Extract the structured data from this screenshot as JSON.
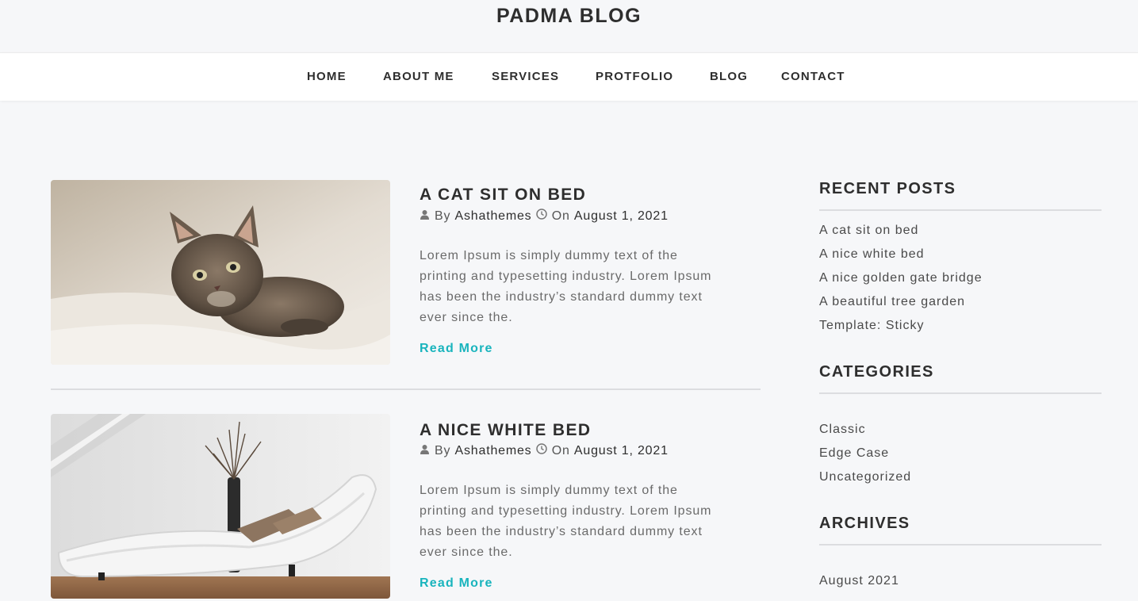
{
  "site": {
    "title": "PADMA BLOG"
  },
  "nav": {
    "items": [
      {
        "label": "HOME"
      },
      {
        "label": "ABOUT ME"
      },
      {
        "label": "SERVICES"
      },
      {
        "label": "PROTFOLIO"
      },
      {
        "label": "BLOG"
      },
      {
        "label": "CONTACT"
      }
    ]
  },
  "posts": [
    {
      "title": "A CAT SIT ON BED",
      "by": "By",
      "author": "Ashathemes",
      "on": "On",
      "date": "August 1, 2021",
      "excerpt": "Lorem Ipsum is simply dummy text of the printing and typesetting industry. Lorem Ipsum has been the industry’s standard dummy text ever since the.",
      "read_more": "Read More",
      "image": "kitten-photo"
    },
    {
      "title": "A NICE WHITE BED",
      "by": "By",
      "author": "Ashathemes",
      "on": "On",
      "date": "August 1, 2021",
      "excerpt": "Lorem Ipsum is simply dummy text of the printing and typesetting industry. Lorem Ipsum has been the industry’s standard dummy text ever since the.",
      "read_more": "Read More",
      "image": "white-chaise-photo"
    }
  ],
  "sidebar": {
    "recent_posts": {
      "title": "RECENT POSTS",
      "items": [
        "A cat sit on bed",
        "A nice white bed",
        "A nice golden gate bridge",
        "A beautiful tree garden",
        "Template: Sticky"
      ]
    },
    "categories": {
      "title": "CATEGORIES",
      "items": [
        "Classic",
        "Edge Case",
        "Uncategorized"
      ]
    },
    "archives": {
      "title": "ARCHIVES",
      "items": [
        "August 2021"
      ]
    }
  },
  "colors": {
    "accent": "#19b4bd",
    "background": "#f6f7f9",
    "text": "#2e2e2e"
  }
}
